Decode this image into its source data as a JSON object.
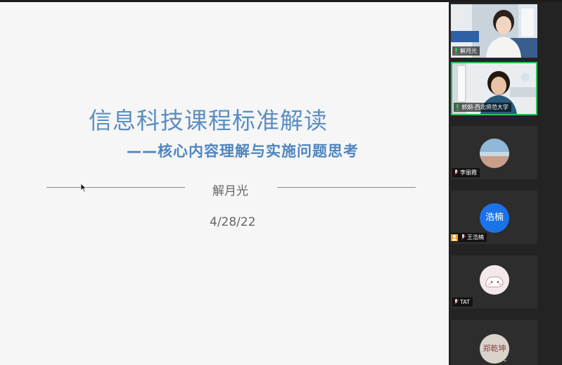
{
  "slide": {
    "title": "信息科技课程标准解读",
    "subtitle": "——核心内容理解与实施问题思考",
    "author": "解月光",
    "date": "4/28/22"
  },
  "participants": [
    {
      "name": "解月光",
      "mic": "on",
      "type": "video"
    },
    {
      "name": "郭炯-西北师范大学",
      "mic": "on",
      "type": "video",
      "speaking": true
    },
    {
      "name": "李丽霞",
      "mic": "off",
      "type": "avatar"
    },
    {
      "name": "王浩楠",
      "mic": "off",
      "type": "initials",
      "initials": "浩楠",
      "avatar_color": "#1a73e8"
    },
    {
      "name": "TAT",
      "mic": "off",
      "type": "avatar"
    },
    {
      "name": "",
      "mic": "off",
      "type": "avatar",
      "avatar_text": "郑乾坤"
    }
  ],
  "icons": [
    "cursor-icon",
    "mic-on-icon",
    "mic-off-icon",
    "person-icon",
    "chevron-down-icon"
  ],
  "colors": {
    "speaking": "#2fbf55",
    "accent": "#5b8ec2"
  }
}
